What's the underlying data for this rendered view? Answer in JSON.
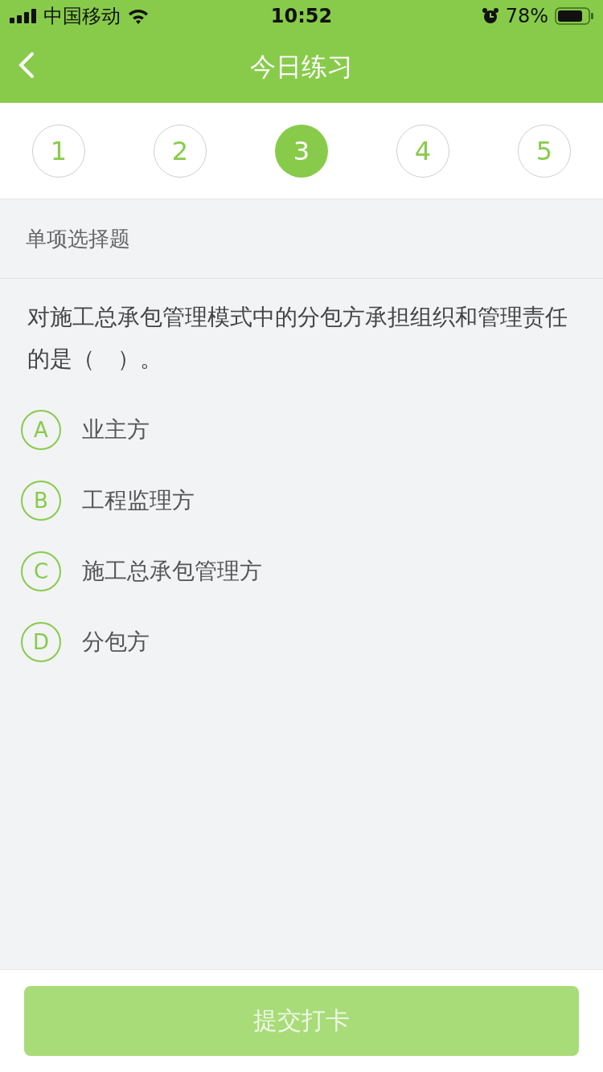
{
  "status_bar": {
    "carrier": "中国移动",
    "time": "10:52",
    "battery": "78%"
  },
  "nav": {
    "title": "今日练习"
  },
  "steps": [
    {
      "label": "1",
      "selected": false
    },
    {
      "label": "2",
      "selected": false
    },
    {
      "label": "3",
      "selected": true
    },
    {
      "label": "4",
      "selected": false
    },
    {
      "label": "5",
      "selected": false
    }
  ],
  "question_type": "单项选择题",
  "question": "对施工总承包管理模式中的分包方承担组织和管理责任的是（　）。",
  "options": [
    {
      "letter": "A",
      "text": "业主方",
      "selected": false
    },
    {
      "letter": "B",
      "text": "工程监理方",
      "selected": false
    },
    {
      "letter": "C",
      "text": "施工总承包管理方",
      "selected": false
    },
    {
      "letter": "D",
      "text": "分包方",
      "selected": false
    }
  ],
  "submit": {
    "label": "提交打卡",
    "disabled": true
  }
}
